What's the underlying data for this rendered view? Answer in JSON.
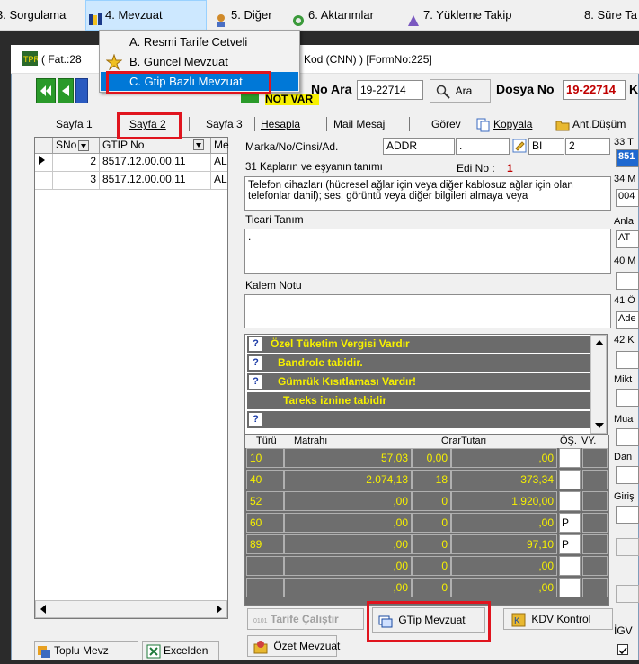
{
  "menubar": {
    "items": [
      {
        "label": "3. Sorgulama"
      },
      {
        "label": "4. Mevzuat"
      },
      {
        "label": "5. Diğer"
      },
      {
        "label": "6. Aktarımlar"
      },
      {
        "label": "7. Yükleme Takip"
      },
      {
        "label": "8. Süre Ta"
      }
    ]
  },
  "dropdown": {
    "items": [
      {
        "label": "A.  Resmi Tarife Cetveli"
      },
      {
        "label": "B.  Güncel Mevzuat"
      },
      {
        "label": "C.  Gtip Bazlı Mevzuat"
      }
    ]
  },
  "window": {
    "title_left": "( Fat.:28",
    "title_right": "Kod (CNN) ) [FormNo:225]"
  },
  "toolbar": {
    "no_ara_label": "No Ara",
    "no_ara_value": "19-22714",
    "not_var": "NOT VAR",
    "ara_label": "Ara",
    "dosya_no_label": "Dosya No",
    "dosya_no_value": "19-22714",
    "dosya_suffix": "K"
  },
  "tabs": [
    {
      "label": "Sayfa 1"
    },
    {
      "label": "Sayfa 2"
    },
    {
      "label": "Sayfa 3"
    },
    {
      "label": "Hesapla"
    },
    {
      "label": "Mail Mesaj"
    },
    {
      "label": "Görev"
    },
    {
      "label": "Kopyala"
    },
    {
      "label": "Ant.Düşüm"
    }
  ],
  "grid": {
    "columns": [
      "SNo",
      "GTIP No",
      "Me"
    ],
    "rows": [
      {
        "sno": "2",
        "gtip": "8517.12.00.00.11",
        "me": "AL"
      },
      {
        "sno": "3",
        "gtip": "8517.12.00.00.11",
        "me": "AL"
      }
    ]
  },
  "form": {
    "marka_label": "Marka/No/Cinsi/Ad.",
    "marka_value": "ADDR",
    "dot_value": ".",
    "bi_value": "BI",
    "num_value": "2",
    "kaplar_label": "31 Kapların ve eşyanın tanımı",
    "edi_label": "Edi No :",
    "edi_value": "1",
    "description": "Telefon cihazları (hücresel ağlar için veya diğer kablosuz ağlar için olan telefonlar dahil); ses, görüntü veya diğer bilgileri almaya veya",
    "ticari_label": "Ticari Tanım",
    "ticari_value": ".",
    "kalem_label": "Kalem Notu"
  },
  "warnings": [
    {
      "icon": "?",
      "text": "Özel Tüketim Vergisi Vardır"
    },
    {
      "icon": "?",
      "text": "Bandrole tabidir."
    },
    {
      "icon": "?",
      "text": "Gümrük Kısıtlaması Vardır!"
    },
    {
      "icon": "",
      "text": "Tareks iznine tabidir"
    },
    {
      "icon": "?",
      "text": ""
    }
  ],
  "tax": {
    "headers": [
      "Türü",
      "Matrahı",
      "Oranı",
      "Tutarı",
      "ÖŞ.",
      "VY."
    ],
    "rows": [
      {
        "turu": "10",
        "matrah": "57,03",
        "oran": "0,00",
        "tutar": ",00",
        "os": ""
      },
      {
        "turu": "40",
        "matrah": "2.074,13",
        "oran": "18",
        "tutar": "373,34",
        "os": ""
      },
      {
        "turu": "52",
        "matrah": ",00",
        "oran": "0",
        "tutar": "1.920,00",
        "os": ""
      },
      {
        "turu": "60",
        "matrah": ",00",
        "oran": "0",
        "tutar": ",00",
        "os": "P"
      },
      {
        "turu": "89",
        "matrah": ",00",
        "oran": "0",
        "tutar": "97,10",
        "os": "P"
      },
      {
        "turu": "",
        "matrah": ",00",
        "oran": "0",
        "tutar": ",00",
        "os": ""
      },
      {
        "turu": "",
        "matrah": ",00",
        "oran": "0",
        "tutar": ",00",
        "os": ""
      }
    ]
  },
  "buttons": {
    "tarife_prefix": "0101",
    "tarife": "Tarife Çalıştır",
    "gtip_mevzuat": "GTip Mevzuat",
    "kdv_kontrol": "KDV Kontrol",
    "ozet_mevzuat": "Özet Mevzuat",
    "toplu_mevz": "Toplu Mevz",
    "excelden": "Excelden"
  },
  "right_column": {
    "labels": [
      "33 T",
      "34 M",
      "Anla",
      "40 M",
      "41 Ö",
      "42 K",
      "Mikt",
      "Mua",
      "Dan",
      "Giriş",
      "İGV"
    ],
    "values": [
      "851",
      "004",
      "AT",
      "Ade"
    ]
  }
}
